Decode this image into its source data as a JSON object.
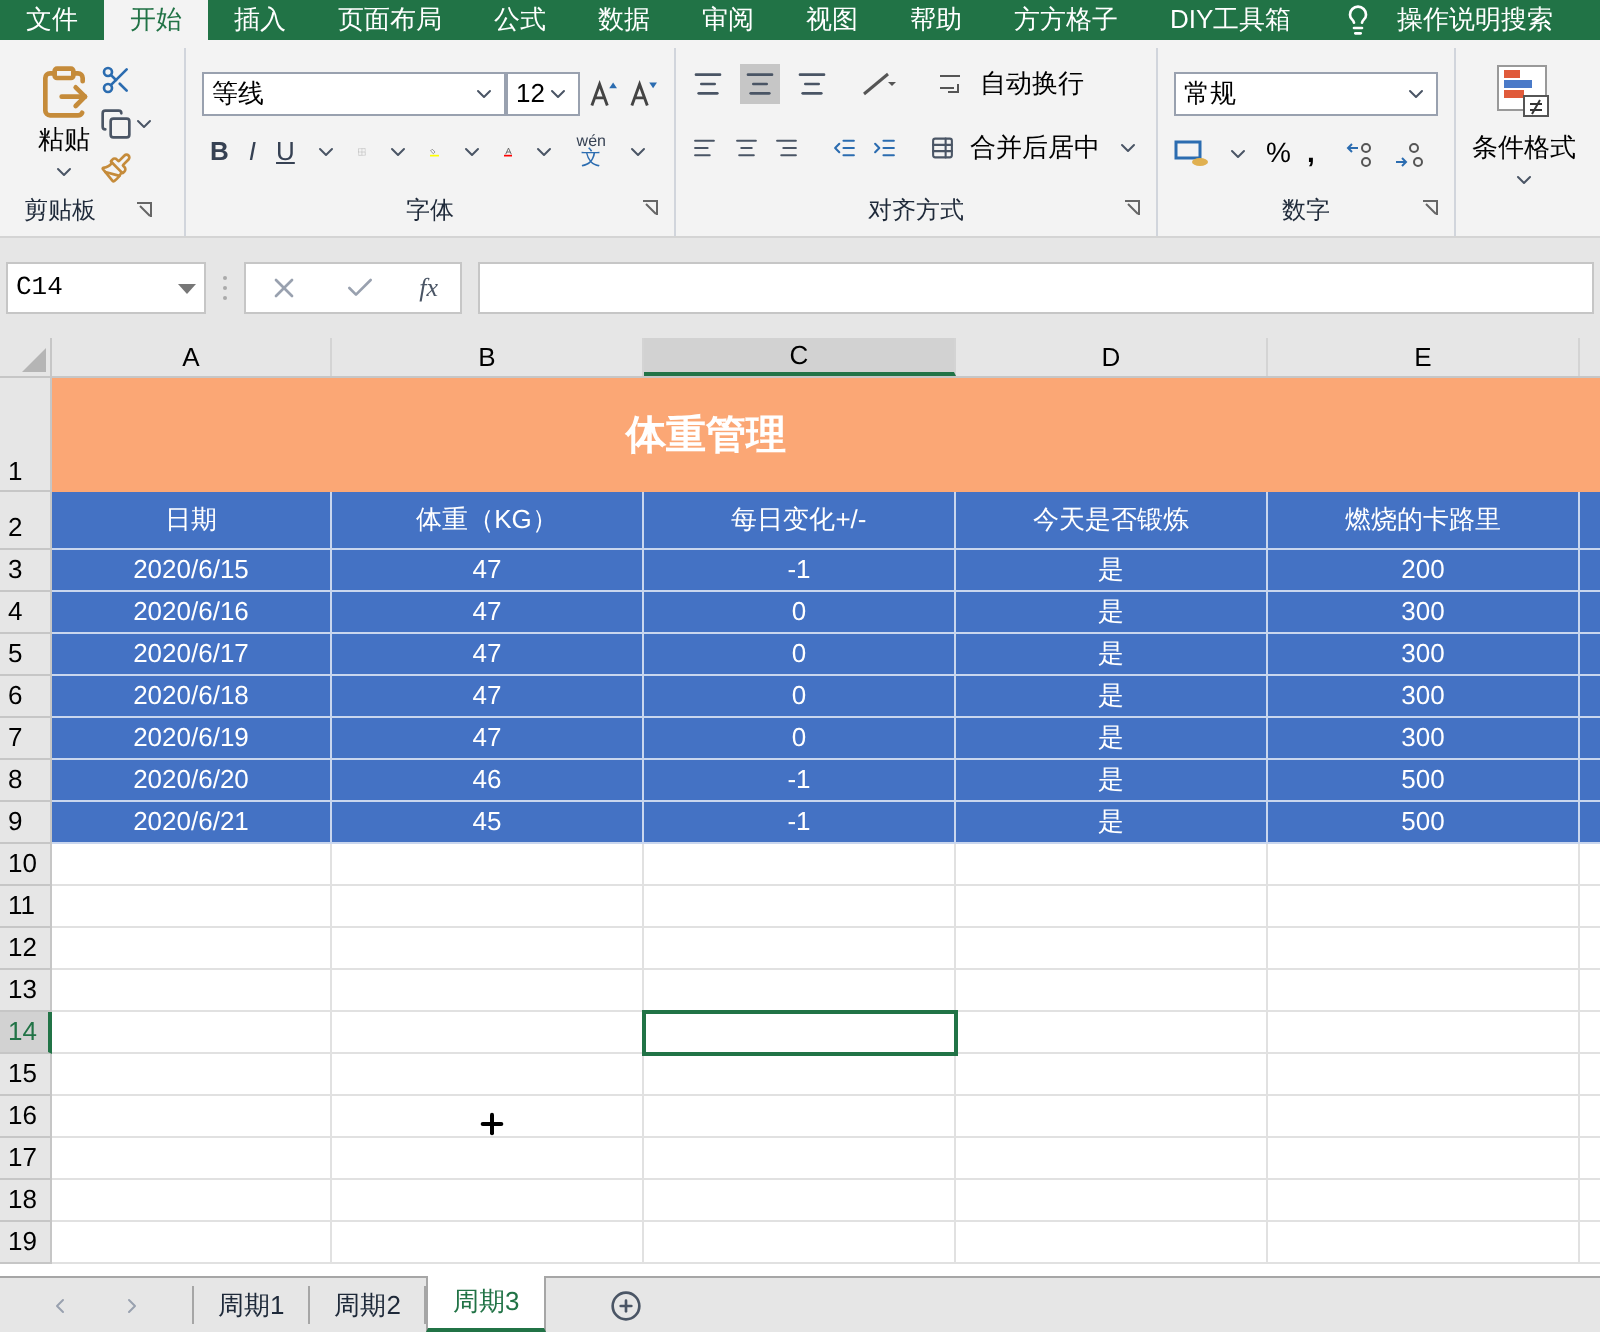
{
  "tabs": [
    {
      "label": "文件",
      "selected": false
    },
    {
      "label": "开始",
      "selected": true
    },
    {
      "label": "插入",
      "selected": false
    },
    {
      "label": "页面布局",
      "selected": false
    },
    {
      "label": "公式",
      "selected": false
    },
    {
      "label": "数据",
      "selected": false
    },
    {
      "label": "审阅",
      "selected": false
    },
    {
      "label": "视图",
      "selected": false
    },
    {
      "label": "帮助",
      "selected": false
    },
    {
      "label": "方方格子",
      "selected": false
    },
    {
      "label": "DIY工具箱",
      "selected": false
    }
  ],
  "tell_me": "操作说明搜索",
  "ribbon": {
    "clipboard": {
      "paste": "粘贴",
      "label": "剪贴板"
    },
    "font": {
      "name": "等线",
      "bold": "B",
      "italic": "I",
      "underline": "U",
      "size": "12",
      "phonetic_top": "wén",
      "phonetic_bottom": "文",
      "label": "字体"
    },
    "alignment": {
      "wrap_text": "自动换行",
      "merge_center": "合并后居中",
      "label": "对齐方式"
    },
    "number": {
      "format": "常规",
      "percent": "%",
      "comma": ",",
      "label": "数字"
    },
    "styles": {
      "conditional_format": "条件格式"
    }
  },
  "formula_bar": {
    "name_box": "C14",
    "fx": "fx"
  },
  "columns": [
    {
      "label": "A",
      "selected": false
    },
    {
      "label": "B",
      "selected": false
    },
    {
      "label": "C",
      "selected": true
    },
    {
      "label": "D",
      "selected": false
    },
    {
      "label": "E",
      "selected": false
    }
  ],
  "title_row": {
    "number": "1",
    "title": "体重管理"
  },
  "header_row": {
    "number": "2",
    "cells": [
      "日期",
      "体重（KG）",
      "每日变化+/-",
      "今天是否锻炼",
      "燃烧的卡路里"
    ]
  },
  "rows": [
    {
      "number": "3",
      "cells": [
        "2020/6/15",
        "47",
        "-1",
        "是",
        "200"
      ]
    },
    {
      "number": "4",
      "cells": [
        "2020/6/16",
        "47",
        "0",
        "是",
        "300"
      ]
    },
    {
      "number": "5",
      "cells": [
        "2020/6/17",
        "47",
        "0",
        "是",
        "300"
      ]
    },
    {
      "number": "6",
      "cells": [
        "2020/6/18",
        "47",
        "0",
        "是",
        "300"
      ]
    },
    {
      "number": "7",
      "cells": [
        "2020/6/19",
        "47",
        "0",
        "是",
        "300"
      ]
    },
    {
      "number": "8",
      "cells": [
        "2020/6/20",
        "46",
        "-1",
        "是",
        "500"
      ]
    },
    {
      "number": "9",
      "cells": [
        "2020/6/21",
        "45",
        "-1",
        "是",
        "500"
      ]
    }
  ],
  "empty_rows": [
    {
      "number": "10",
      "selected": false
    },
    {
      "number": "11",
      "selected": false
    },
    {
      "number": "12",
      "selected": false
    },
    {
      "number": "13",
      "selected": false
    },
    {
      "number": "14",
      "selected": true
    },
    {
      "number": "15",
      "selected": false
    },
    {
      "number": "16",
      "selected": false
    },
    {
      "number": "17",
      "selected": false
    },
    {
      "number": "18",
      "selected": false
    },
    {
      "number": "19",
      "selected": false
    }
  ],
  "sheet_tabs": [
    {
      "label": "周期1",
      "selected": false
    },
    {
      "label": "周期2",
      "selected": false
    },
    {
      "label": "周期3",
      "selected": true
    }
  ]
}
